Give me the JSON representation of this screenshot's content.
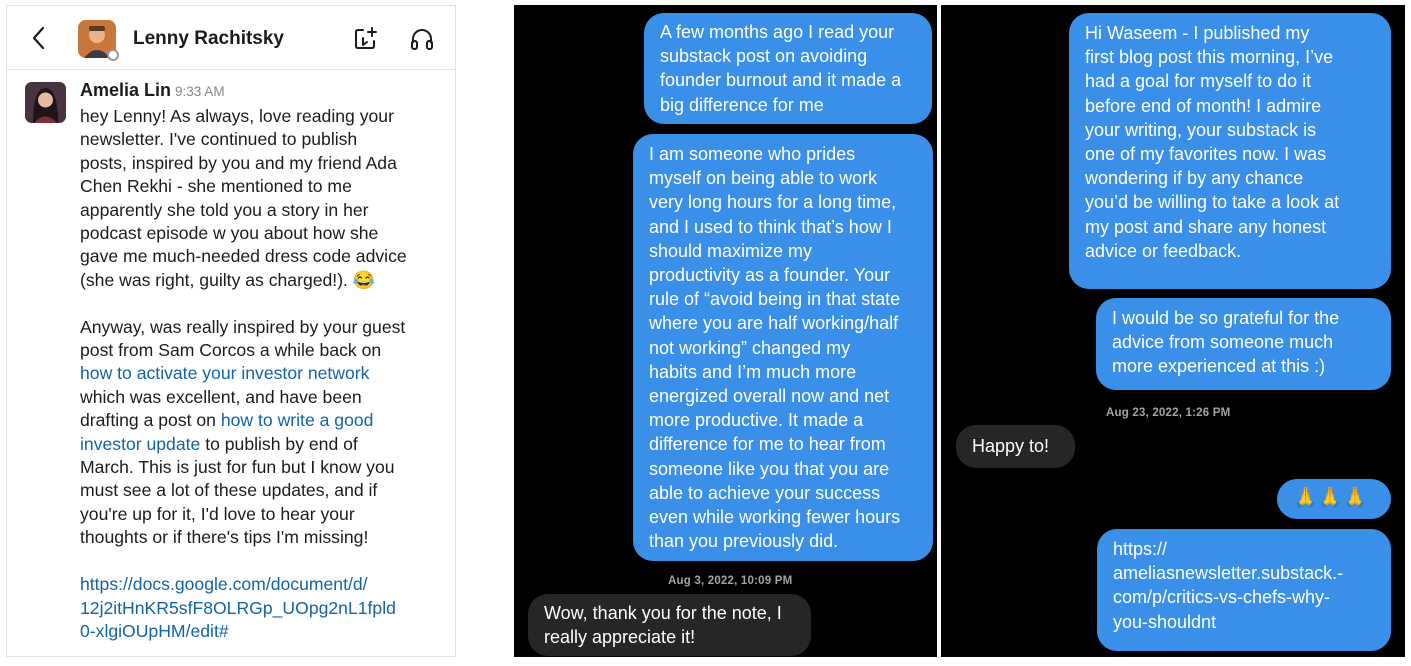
{
  "slack": {
    "header": {
      "back_icon": "chevron-left-icon",
      "contact_name": "Lenny Rachitsky",
      "add_icon": "add-to-channel-icon",
      "huddle_icon": "headphones-icon"
    },
    "message": {
      "sender": "Amelia Lin",
      "time": "9:33 AM",
      "para1_lines": [
        "hey Lenny! As always, love reading your",
        "newsletter. I've continued to publish",
        "posts, inspired by you and my friend Ada",
        "Chen Rekhi - she mentioned to me",
        "apparently she told you a story in her",
        "podcast episode w you about how she",
        "gave me much-needed dress code advice",
        "(she was right, guilty as charged!)."
      ],
      "emoji": "😂",
      "para2_a": "Anyway, was really inspired by your guest",
      "para2_b": "post from Sam Corcos a while back on",
      "link1": "how to activate your investor network",
      "para2_c": "which was excellent, and have been",
      "para2_d": "drafting a post on ",
      "link2_a": "how to write a good",
      "link2_b": "investor update",
      "para2_e": " to publish by end of",
      "para2_f": "March. This is just for fun but I know you",
      "para2_g": "must see a lot of these updates, and if",
      "para2_h": "you're up for it, I'd love to hear your",
      "para2_i": "thoughts or if there's tips I'm missing!",
      "url_lines": [
        "https://docs.google.com/document/d/",
        "12j2itHnKR5sfF8OLRGp_UOpg2nL1fpld",
        "0-xlgiOUpHM/edit#"
      ]
    }
  },
  "dm1": {
    "bubble1": [
      "A few months ago I read your",
      "substack post on avoiding",
      "founder burnout and it made a",
      "big difference for me"
    ],
    "bubble2": [
      "I am someone who prides",
      "myself on being able to work",
      "very long hours for a long time,",
      "and I used to think that’s how I",
      "should maximize my",
      "productivity as a founder. Your",
      "rule of “avoid being in that state",
      "where you are half working/half",
      "not working” changed my",
      "habits and I’m much more",
      "energized overall now and net",
      "more productive. It made a",
      "difference for me to hear from",
      "someone like you that you are",
      "able to achieve your success",
      "even while working fewer hours",
      "than you previously did."
    ],
    "timestamp": "Aug 3, 2022, 10:09 PM",
    "reply": [
      "Wow, thank you for the note, I",
      "really appreciate it!"
    ]
  },
  "dm2": {
    "bubble1": [
      "Hi Waseem - I published my",
      "first blog post this morning, I’ve",
      "had a goal for myself to do it",
      "before end of month! I admire",
      "your writing, your substack is",
      "one of my favorites now. I was",
      "wondering if by any chance",
      "you’d be willing to take a look at",
      "my post and share any honest",
      "advice or feedback."
    ],
    "bubble2": [
      "I would be so grateful for the",
      "advice from someone much",
      "more experienced at this :)"
    ],
    "timestamp": "Aug 23, 2022, 1:26 PM",
    "reply": "Happy to!",
    "emoji_bubble": "🙏🙏🙏",
    "link_bubble": [
      "https://",
      "ameliasnewsletter.substack.-",
      "com/p/critics-vs-chefs-why-",
      "you-shouldnt"
    ]
  },
  "colors": {
    "outgoing_bubble": "#3a8fe8",
    "incoming_bubble": "#262626",
    "link": "#1264a3"
  }
}
